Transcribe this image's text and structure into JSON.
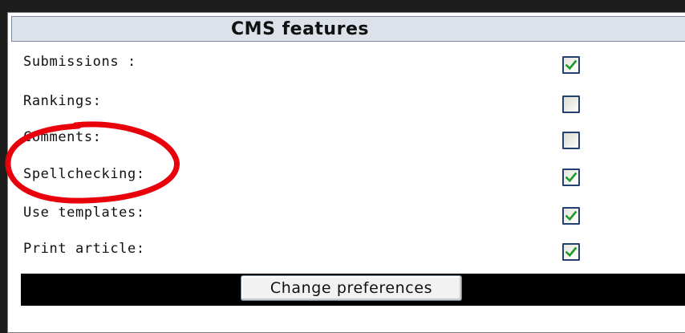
{
  "panel": {
    "title": "CMS features",
    "rows": [
      {
        "label": "Submissions :",
        "checked": true
      },
      {
        "label": "Rankings:",
        "checked": false
      },
      {
        "label": "Comments:",
        "checked": false
      },
      {
        "label": "Spellchecking:",
        "checked": true
      },
      {
        "label": "Use templates:",
        "checked": true
      },
      {
        "label": "Print article:",
        "checked": true
      }
    ],
    "submit_label": "Change preferences"
  },
  "colors": {
    "check": "#1e9a24",
    "annotation": "#e8000b",
    "header_bg": "#dde2ea",
    "button_bar": "#000000"
  }
}
